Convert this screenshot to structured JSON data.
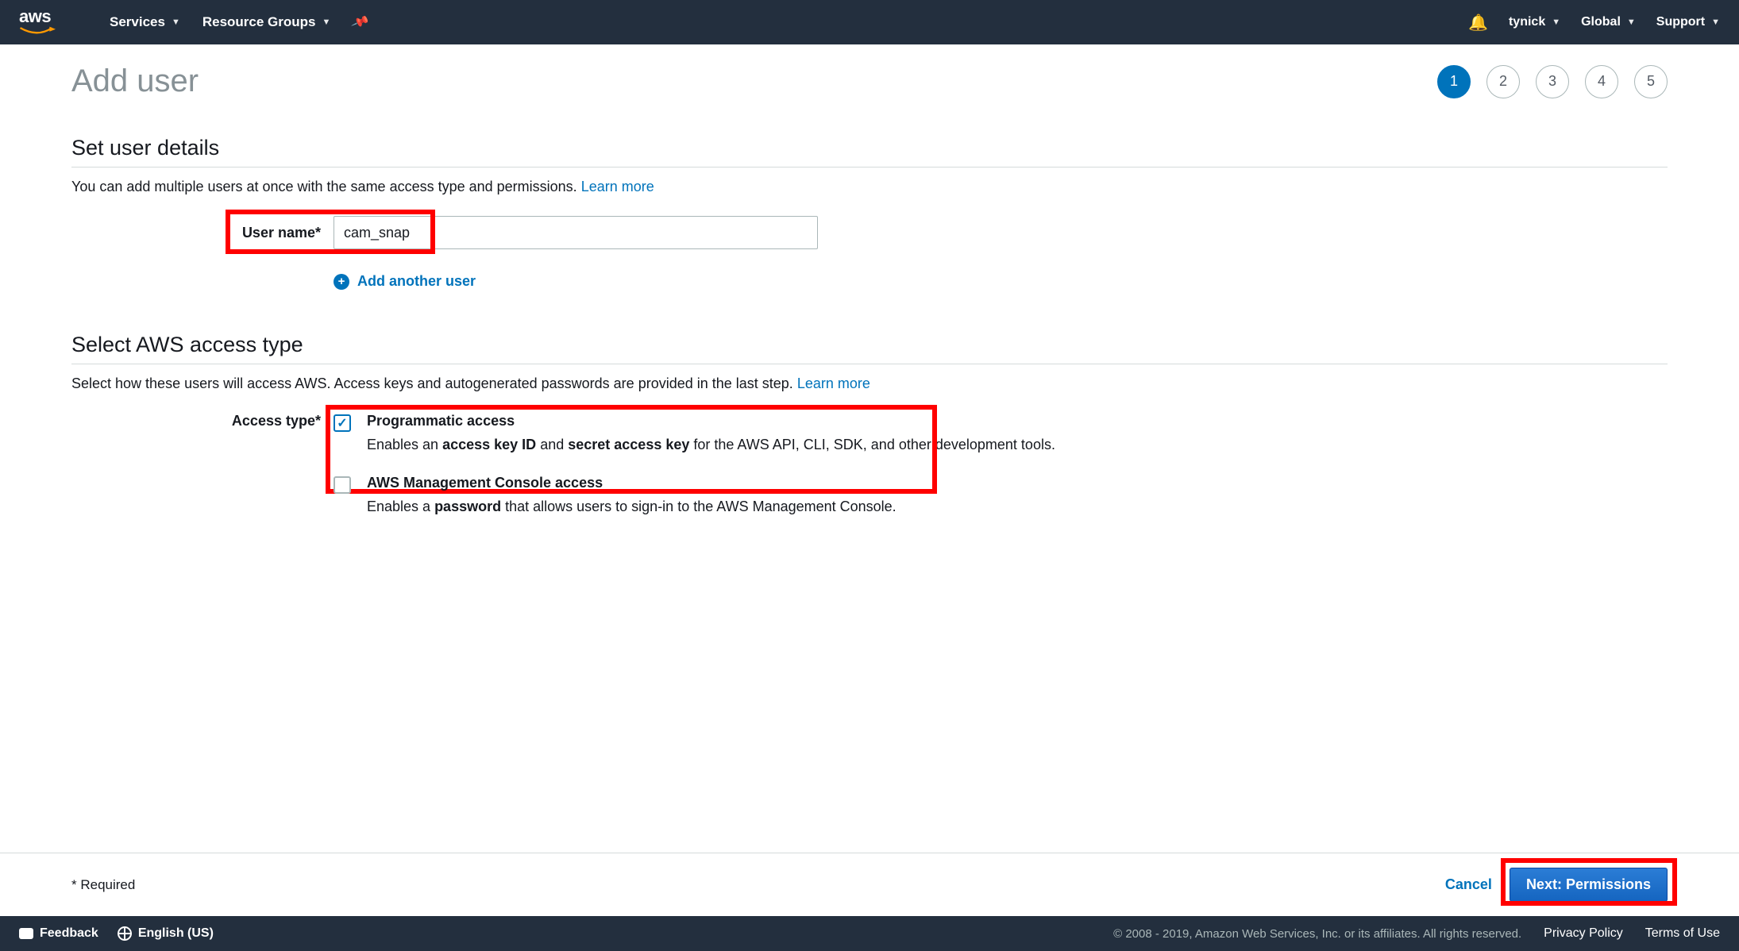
{
  "nav": {
    "logo_text": "aws",
    "services": "Services",
    "resource_groups": "Resource Groups",
    "user": "tynick",
    "region": "Global",
    "support": "Support"
  },
  "page": {
    "title": "Add user"
  },
  "steps": [
    "1",
    "2",
    "3",
    "4",
    "5"
  ],
  "section1": {
    "title": "Set user details",
    "desc": "You can add multiple users at once with the same access type and permissions. ",
    "learn_more": "Learn more",
    "username_label": "User name*",
    "username_value": "cam_snap",
    "add_another": "Add another user"
  },
  "section2": {
    "title": "Select AWS access type",
    "desc": "Select how these users will access AWS. Access keys and autogenerated passwords are provided in the last step. ",
    "learn_more": "Learn more",
    "access_type_label": "Access type*",
    "option1": {
      "title": "Programmatic access",
      "desc_pre": "Enables an ",
      "b1": "access key ID",
      "mid": " and ",
      "b2": "secret access key",
      "desc_post": " for the AWS API, CLI, SDK, and other development tools.",
      "checked": true
    },
    "option2": {
      "title": "AWS Management Console access",
      "desc_pre": "Enables a ",
      "b1": "password",
      "desc_post": " that allows users to sign-in to the AWS Management Console.",
      "checked": false
    }
  },
  "actions": {
    "required": "* Required",
    "cancel": "Cancel",
    "next": "Next: Permissions"
  },
  "footer": {
    "feedback": "Feedback",
    "language": "English (US)",
    "copyright": "© 2008 - 2019, Amazon Web Services, Inc. or its affiliates. All rights reserved.",
    "privacy": "Privacy Policy",
    "terms": "Terms of Use"
  }
}
